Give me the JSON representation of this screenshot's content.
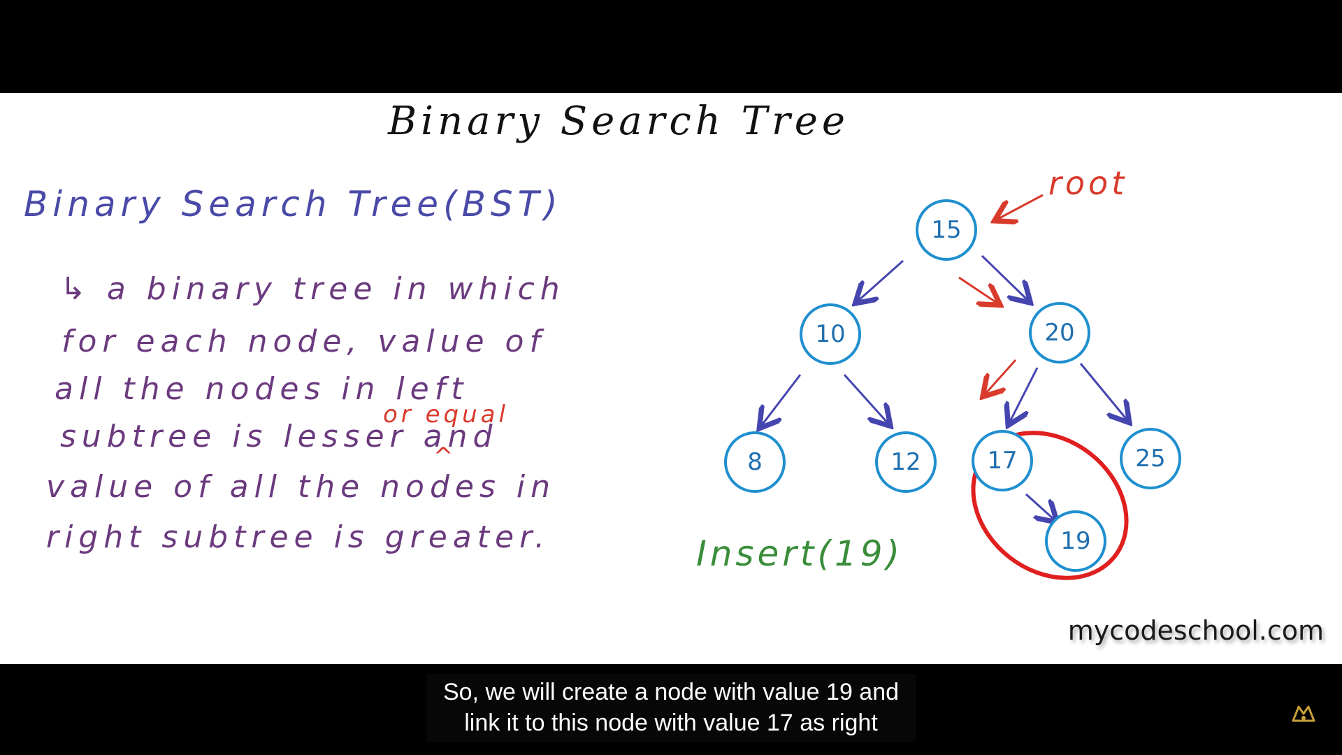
{
  "slide": {
    "title": "Binary Search Tree",
    "subtitle": "Binary Search Tree(BST)",
    "definition_lines": [
      "↳ a binary tree in which",
      "for each node, value of",
      "all the nodes in left",
      "subtree is lesser  and",
      "value of all the nodes in",
      "right subtree is greater."
    ],
    "insert_note": "or equal",
    "insert_caret": "^",
    "root_label": "root",
    "insert_label": "Insert(19)",
    "watermark": "mycodeschool.com"
  },
  "tree": {
    "nodes": [
      {
        "key": "15",
        "value": "15"
      },
      {
        "key": "10",
        "value": "10"
      },
      {
        "key": "20",
        "value": "20"
      },
      {
        "key": "8",
        "value": "8"
      },
      {
        "key": "12",
        "value": "12"
      },
      {
        "key": "17",
        "value": "17"
      },
      {
        "key": "25",
        "value": "25"
      },
      {
        "key": "19",
        "value": "19"
      }
    ]
  },
  "caption": {
    "line1": "So, we will create a node with value 19 and",
    "line2": "link it to this node with value 17 as right"
  },
  "colors": {
    "title": "#111111",
    "subtitle": "#4a4aa8",
    "definition": "#6b3a7e",
    "annotation": "#d83a2c",
    "node_outline": "#1f8fcf",
    "edge": "#4545b0",
    "insert": "#3a8d3a"
  },
  "icons": {
    "corner": "logo-icon"
  }
}
